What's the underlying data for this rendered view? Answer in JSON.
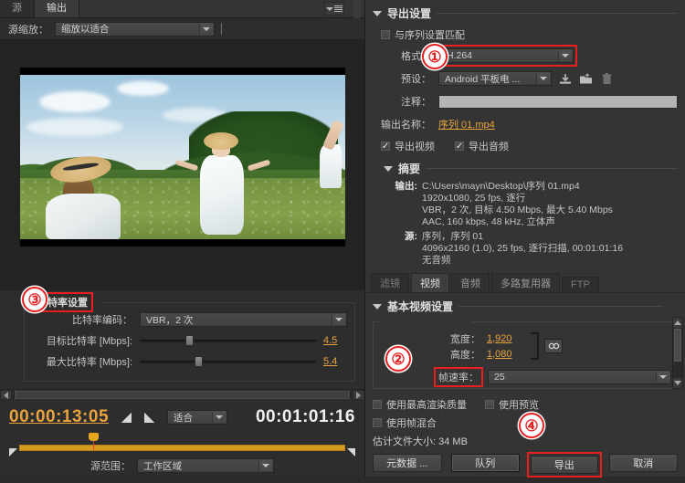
{
  "left": {
    "tabs": [
      {
        "label": "源",
        "active": false
      },
      {
        "label": "输出",
        "active": true
      }
    ],
    "source_scale": {
      "label": "源缩放：",
      "value": "缩放以适合"
    },
    "bitrate": {
      "title": "比特率设置",
      "encoding": {
        "label": "比特率编码：",
        "value": "VBR，2 次"
      },
      "target": {
        "label": "目标比特率 [Mbps]:",
        "value": "4.5",
        "percent": 26
      },
      "maximum": {
        "label": "最大比特率 [Mbps]:",
        "value": "5.4",
        "percent": 31
      }
    },
    "transport": {
      "timecode_in": "00:00:13:05",
      "timecode_out": "00:01:01:16",
      "zoom": "适合",
      "playhead_percent": 23,
      "source_range": {
        "label": "源范围：",
        "value": "工作区域"
      }
    }
  },
  "right": {
    "export_settings": {
      "title": "导出设置",
      "match_sequence": {
        "label": "与序列设置匹配",
        "checked": false
      },
      "format": {
        "label": "格式：",
        "value": "H.264"
      },
      "preset": {
        "label": "预设：",
        "value": "Android 平板电 ..."
      },
      "comment": {
        "label": "注释：",
        "value": ""
      },
      "output_name": {
        "label": "输出名称：",
        "value": "序列 01.mp4"
      },
      "export_video": {
        "label": "导出视频",
        "checked": true
      },
      "export_audio": {
        "label": "导出音频",
        "checked": true
      }
    },
    "summary": {
      "title": "摘要",
      "output_key": "输出:",
      "output_lines": [
        "C:\\Users\\mayn\\Desktop\\序列 01.mp4",
        "1920x1080, 25 fps, 逐行",
        "VBR，2 次, 目标 4.50 Mbps, 最大 5.40 Mbps",
        "AAC, 160 kbps, 48 kHz, 立体声"
      ],
      "source_key": "源:",
      "source_lines": [
        "序列，序列 01",
        "4096x2160 (1.0), 25 fps, 逐行扫描, 00:01:01:16",
        "无音频"
      ]
    },
    "tabs": [
      {
        "label": "滤镜",
        "active": false,
        "dim": true
      },
      {
        "label": "视频",
        "active": true,
        "dim": false
      },
      {
        "label": "音频",
        "active": false,
        "dim": false
      },
      {
        "label": "多路复用器",
        "active": false,
        "dim": false
      },
      {
        "label": "FTP",
        "active": false,
        "dim": true
      }
    ],
    "video_settings": {
      "title": "基本视频设置",
      "width": {
        "label": "宽度：",
        "value": "1,920"
      },
      "height": {
        "label": "高度：",
        "value": "1,080"
      },
      "frame_rate": {
        "label": "帧速率：",
        "value": "25"
      },
      "link_icon": "link-chain-icon"
    },
    "footer": {
      "max_render_quality": {
        "label": "使用最高渲染质量",
        "checked": false
      },
      "use_preview": {
        "label": "使用预览",
        "checked": false
      },
      "frame_blending": {
        "label": "使用帧混合",
        "checked": false
      },
      "estimated_size_label": "估计文件大小:",
      "estimated_size_value": "34 MB",
      "buttons": {
        "metadata": "元数据 ...",
        "queue": "队列",
        "export": "导出",
        "cancel": "取消"
      }
    }
  },
  "markers": {
    "one": "①",
    "two": "②",
    "three": "③",
    "four": "④"
  },
  "colors": {
    "highlight_red": "#e81f1f",
    "accent_orange": "#e8a33d",
    "panel_bg": "#343434",
    "timeline_bar": "#d79a20"
  }
}
